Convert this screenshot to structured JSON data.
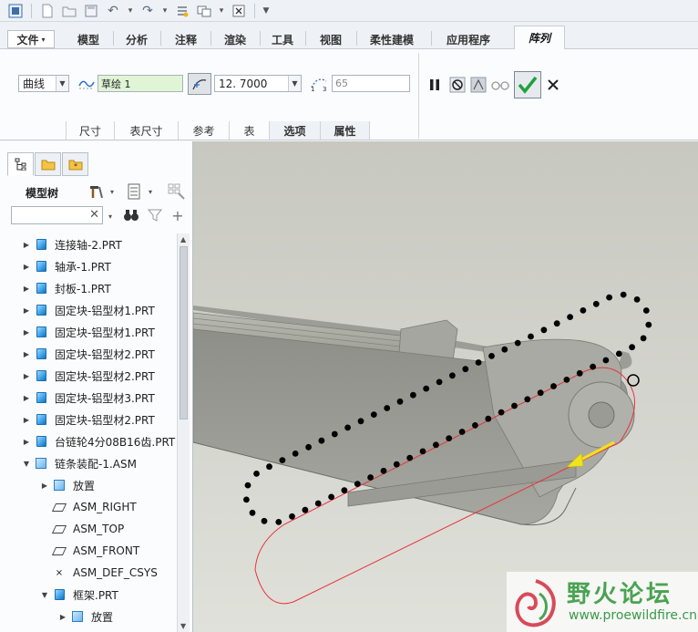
{
  "qat": {
    "icons": [
      "window-icon",
      "new-icon",
      "open-icon",
      "save-icon",
      "undo-icon",
      "redo-icon",
      "regenerate-icon",
      "windows-icon",
      "close-window-icon",
      "customize-icon"
    ]
  },
  "tabs": [
    "文件",
    "模型",
    "分析",
    "注释",
    "渲染",
    "工具",
    "视图",
    "柔性建模",
    "应用程序",
    "阵列"
  ],
  "ribbon": {
    "pattern_type": "曲线",
    "sketch_label": "草绘 1",
    "spacing_value": "12. 7000",
    "count_value": "65",
    "subtabs": [
      "尺寸",
      "表尺寸",
      "参考",
      "表",
      "选项",
      "属性"
    ]
  },
  "panel": {
    "title": "模型树",
    "search_value": ""
  },
  "tree": [
    {
      "label": "连接轴-2.PRT",
      "type": "part",
      "indent": 0,
      "expander": "collapsed"
    },
    {
      "label": "轴承-1.PRT",
      "type": "part",
      "indent": 0,
      "expander": "collapsed"
    },
    {
      "label": "封板-1.PRT",
      "type": "part",
      "indent": 0,
      "expander": "collapsed"
    },
    {
      "label": "固定块-铝型材1.PRT",
      "type": "part",
      "indent": 0,
      "expander": "collapsed"
    },
    {
      "label": "固定块-铝型材1.PRT",
      "type": "part",
      "indent": 0,
      "expander": "collapsed"
    },
    {
      "label": "固定块-铝型材2.PRT",
      "type": "part",
      "indent": 0,
      "expander": "collapsed"
    },
    {
      "label": "固定块-铝型材2.PRT",
      "type": "part",
      "indent": 0,
      "expander": "collapsed"
    },
    {
      "label": "固定块-铝型材3.PRT",
      "type": "part",
      "indent": 0,
      "expander": "collapsed"
    },
    {
      "label": "固定块-铝型材2.PRT",
      "type": "part",
      "indent": 0,
      "expander": "collapsed"
    },
    {
      "label": "台链轮4分08B16齿.PRT",
      "type": "part",
      "indent": 0,
      "expander": "collapsed"
    },
    {
      "label": "链条装配-1.ASM",
      "type": "asm",
      "indent": 0,
      "expander": "expanded"
    },
    {
      "label": "放置",
      "type": "asm",
      "indent": 1,
      "expander": "collapsed"
    },
    {
      "label": "ASM_RIGHT",
      "type": "datum",
      "indent": 1,
      "expander": "none"
    },
    {
      "label": "ASM_TOP",
      "type": "datum",
      "indent": 1,
      "expander": "none"
    },
    {
      "label": "ASM_FRONT",
      "type": "datum",
      "indent": 1,
      "expander": "none"
    },
    {
      "label": "ASM_DEF_CSYS",
      "type": "csys",
      "indent": 1,
      "expander": "none"
    },
    {
      "label": "框架.PRT",
      "type": "part",
      "indent": 1,
      "expander": "expanded"
    },
    {
      "label": "放置",
      "type": "asm",
      "indent": 2,
      "expander": "collapsed"
    }
  ],
  "watermark": {
    "title": "野火论坛",
    "url": "www.proewildfire.cn"
  },
  "colors": {
    "path_red": "#e8333c",
    "chain_black": "#000000",
    "arrow_yellow": "#f2e21a",
    "watermark_green": "#4aa352"
  }
}
